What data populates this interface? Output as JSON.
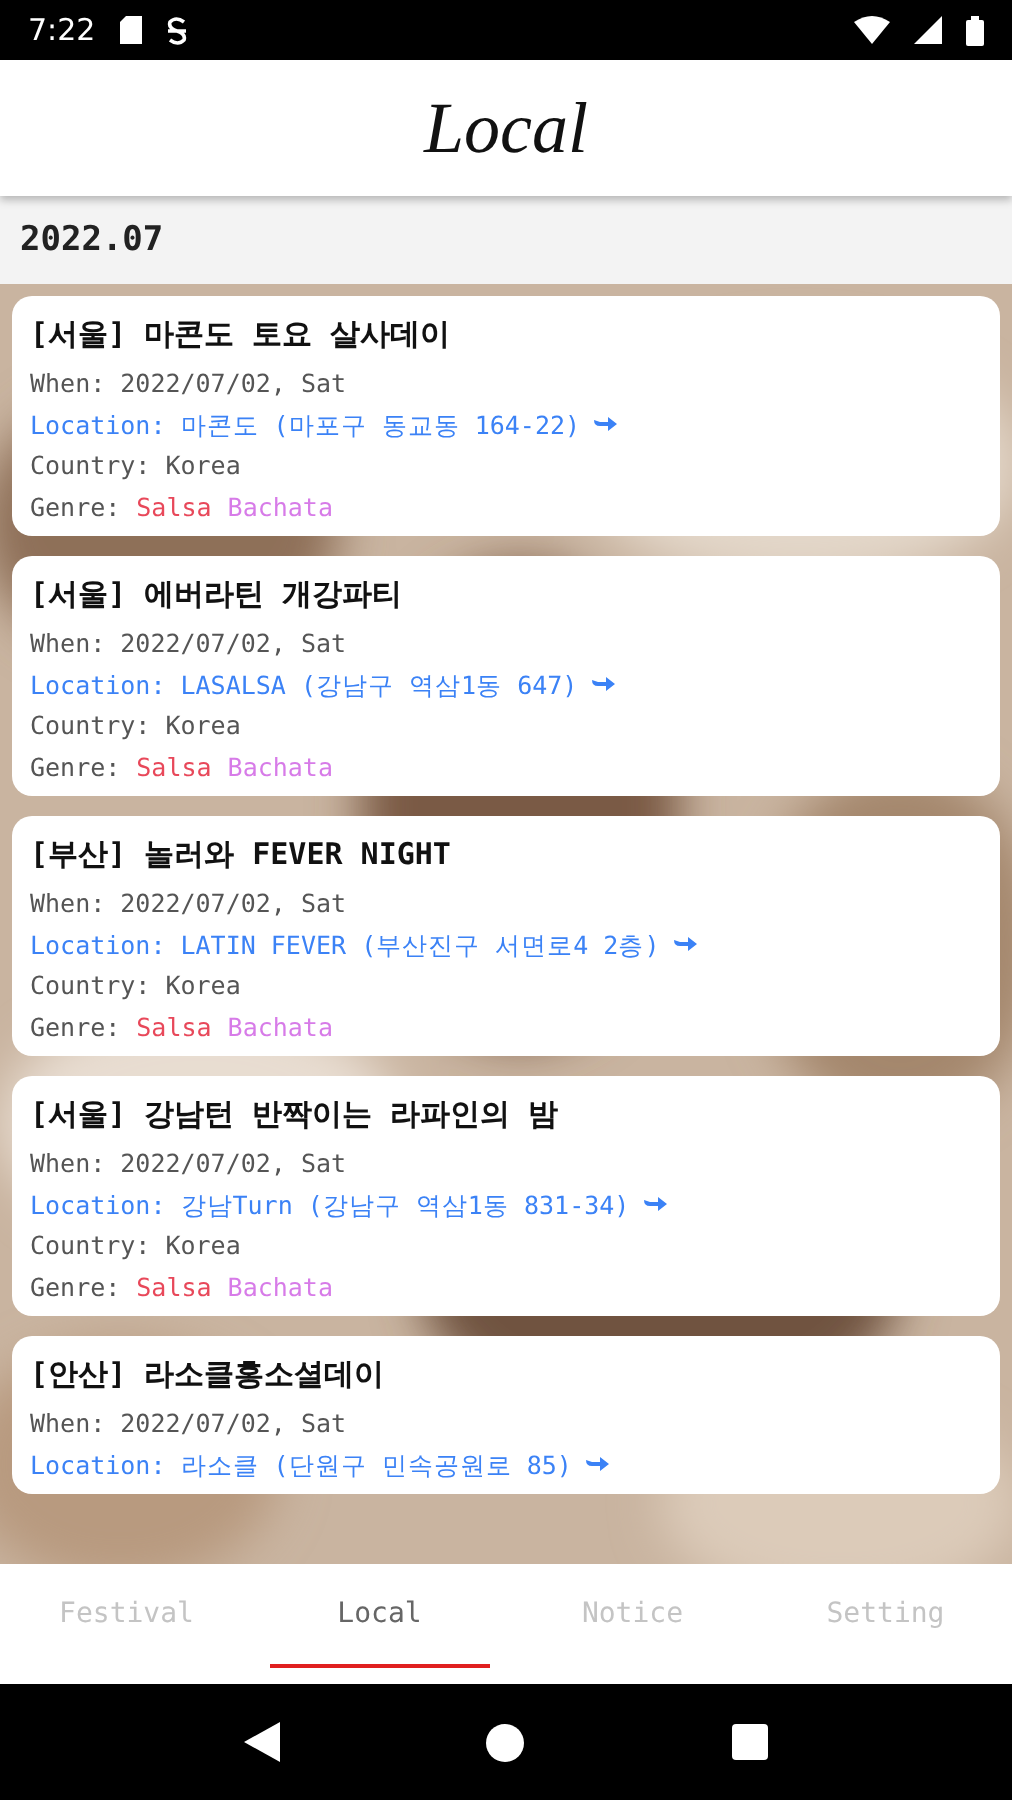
{
  "status_bar": {
    "time": "7:22"
  },
  "header": {
    "title": "Local"
  },
  "month": "2022.07",
  "events": [
    {
      "title": "[서울] 마콘도 토요 살사데이",
      "when": "When: 2022/07/02, Sat",
      "location": "Location: 마콘도 (마포구 동교동 164-22)",
      "country": "Country: Korea",
      "genre_label": "Genre:",
      "genres": [
        {
          "name": "Salsa",
          "color": "#e8485a"
        },
        {
          "name": "Bachata",
          "color": "#d77be8"
        }
      ]
    },
    {
      "title": "[서울] 에버라틴 개강파티",
      "when": "When: 2022/07/02, Sat",
      "location": "Location: LASALSA (강남구 역삼1동 647)",
      "country": "Country: Korea",
      "genre_label": "Genre:",
      "genres": [
        {
          "name": "Salsa",
          "color": "#e8485a"
        },
        {
          "name": "Bachata",
          "color": "#d77be8"
        }
      ]
    },
    {
      "title": "[부산] 놀러와 FEVER NIGHT",
      "when": "When: 2022/07/02, Sat",
      "location": "Location: LATIN FEVER (부산진구 서면로4 2층)",
      "country": "Country: Korea",
      "genre_label": "Genre:",
      "genres": [
        {
          "name": "Salsa",
          "color": "#e8485a"
        },
        {
          "name": "Bachata",
          "color": "#d77be8"
        }
      ]
    },
    {
      "title": "[서울] 강남턴 반짝이는 라파인의 밤",
      "when": "When: 2022/07/02, Sat",
      "location": "Location: 강남Turn (강남구 역삼1동 831-34)",
      "country": "Country: Korea",
      "genre_label": "Genre:",
      "genres": [
        {
          "name": "Salsa",
          "color": "#e8485a"
        },
        {
          "name": "Bachata",
          "color": "#d77be8"
        }
      ]
    },
    {
      "title": "[안산] 라소클홍소셜데이",
      "when": "When: 2022/07/02, Sat",
      "location": "Location: 라소클 (단원구 민속공원로 85)"
    }
  ],
  "tabs": [
    {
      "label": "Festival",
      "selected": false
    },
    {
      "label": "Local",
      "selected": true
    },
    {
      "label": "Notice",
      "selected": false
    },
    {
      "label": "Setting",
      "selected": false
    }
  ]
}
